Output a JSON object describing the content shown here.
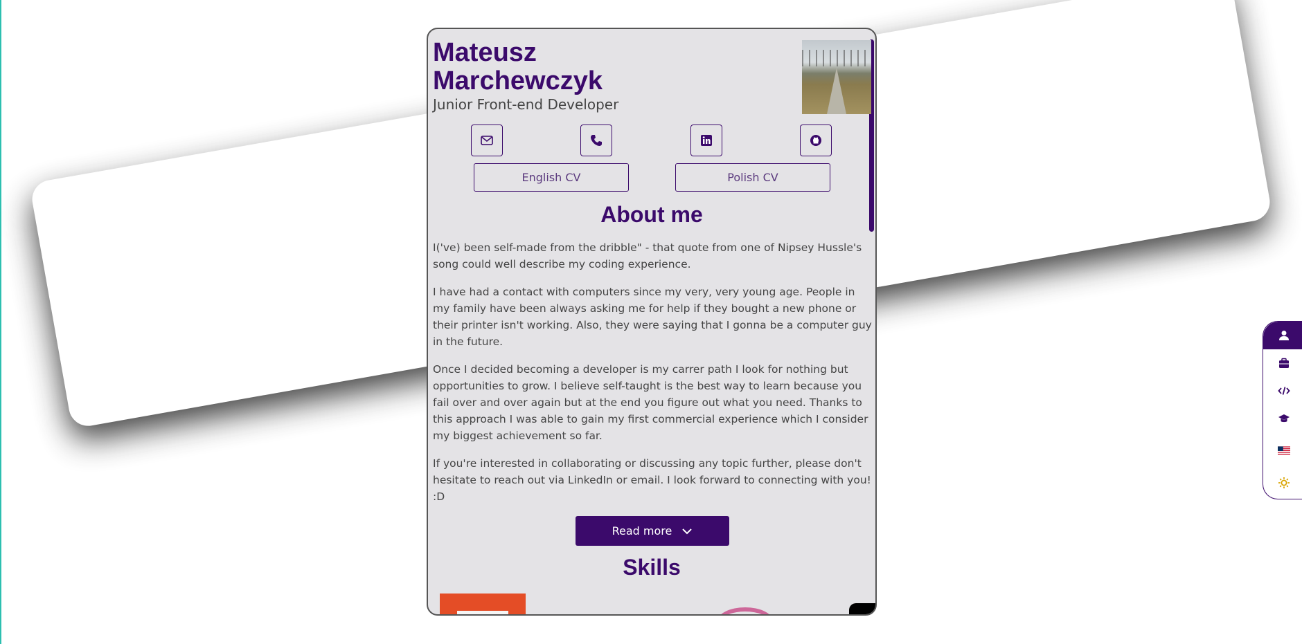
{
  "profile": {
    "name_line1": "Mateusz",
    "name_line2": "Marchewczyk",
    "role": "Junior Front-end Developer"
  },
  "contact_icons": [
    "envelope-icon",
    "phone-icon",
    "linkedin-icon",
    "github-icon"
  ],
  "cv_buttons": {
    "english": "English CV",
    "polish": "Polish CV"
  },
  "about": {
    "title": "About me",
    "paragraphs": [
      "I('ve) been self-made from the dribble\" - that quote from one of Nipsey Hussle's song could well describe my coding experience.",
      "I have had a contact with computers since my very, very young age. People in my family have been always asking me for help if they bought a new phone or their printer isn't working. Also, they were saying that I gonna be a computer guy in the future.",
      "Once I decided becoming a developer is my carrer path I look for nothing but opportunities to grow. I believe self-taught is the best way to learn because you fail over and over again but at the end you figure out what you need. Thanks to this approach I was able to gain my first commercial experience which I consider my biggest achievement so far.",
      "If you're interested in collaborating or discussing any topic further, please don't hesitate to reach out via LinkedIn or email. I look forward to connecting with you! :D"
    ],
    "read_more": "Read more"
  },
  "skills": {
    "title": "Skills",
    "logos": [
      "html5-logo",
      "sass-logo",
      "black-logo"
    ]
  },
  "dock": {
    "items": [
      "user-icon",
      "briefcase-icon",
      "code-icon",
      "graduation-cap-icon",
      "us-flag-icon",
      "sun-icon"
    ],
    "active": "user-icon"
  },
  "colors": {
    "accent": "#3b0a6b",
    "panel_bg": "#e4e3e6",
    "text": "#444444"
  }
}
